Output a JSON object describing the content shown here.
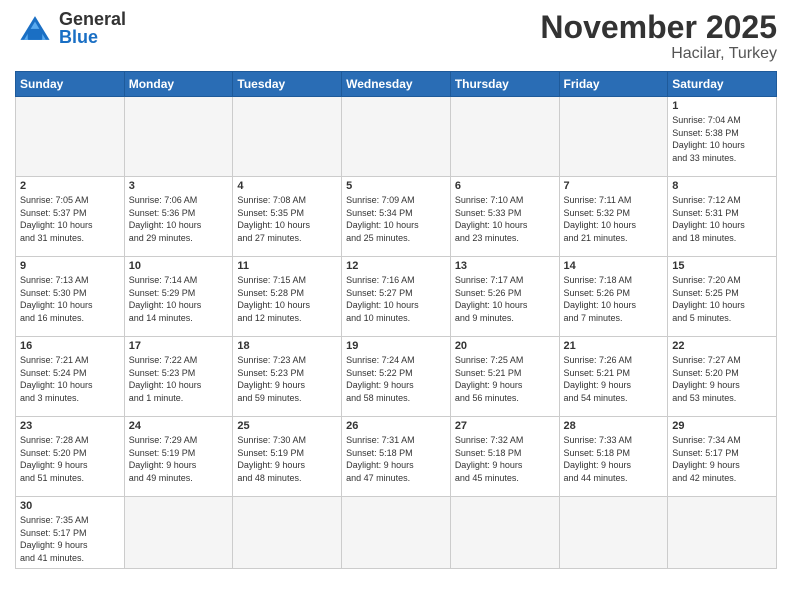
{
  "header": {
    "logo_general": "General",
    "logo_blue": "Blue",
    "month": "November 2025",
    "location": "Hacilar, Turkey"
  },
  "weekdays": [
    "Sunday",
    "Monday",
    "Tuesday",
    "Wednesday",
    "Thursday",
    "Friday",
    "Saturday"
  ],
  "weeks": [
    [
      {
        "day": "",
        "info": ""
      },
      {
        "day": "",
        "info": ""
      },
      {
        "day": "",
        "info": ""
      },
      {
        "day": "",
        "info": ""
      },
      {
        "day": "",
        "info": ""
      },
      {
        "day": "",
        "info": ""
      },
      {
        "day": "1",
        "info": "Sunrise: 7:04 AM\nSunset: 5:38 PM\nDaylight: 10 hours\nand 33 minutes."
      }
    ],
    [
      {
        "day": "2",
        "info": "Sunrise: 7:05 AM\nSunset: 5:37 PM\nDaylight: 10 hours\nand 31 minutes."
      },
      {
        "day": "3",
        "info": "Sunrise: 7:06 AM\nSunset: 5:36 PM\nDaylight: 10 hours\nand 29 minutes."
      },
      {
        "day": "4",
        "info": "Sunrise: 7:08 AM\nSunset: 5:35 PM\nDaylight: 10 hours\nand 27 minutes."
      },
      {
        "day": "5",
        "info": "Sunrise: 7:09 AM\nSunset: 5:34 PM\nDaylight: 10 hours\nand 25 minutes."
      },
      {
        "day": "6",
        "info": "Sunrise: 7:10 AM\nSunset: 5:33 PM\nDaylight: 10 hours\nand 23 minutes."
      },
      {
        "day": "7",
        "info": "Sunrise: 7:11 AM\nSunset: 5:32 PM\nDaylight: 10 hours\nand 21 minutes."
      },
      {
        "day": "8",
        "info": "Sunrise: 7:12 AM\nSunset: 5:31 PM\nDaylight: 10 hours\nand 18 minutes."
      }
    ],
    [
      {
        "day": "9",
        "info": "Sunrise: 7:13 AM\nSunset: 5:30 PM\nDaylight: 10 hours\nand 16 minutes."
      },
      {
        "day": "10",
        "info": "Sunrise: 7:14 AM\nSunset: 5:29 PM\nDaylight: 10 hours\nand 14 minutes."
      },
      {
        "day": "11",
        "info": "Sunrise: 7:15 AM\nSunset: 5:28 PM\nDaylight: 10 hours\nand 12 minutes."
      },
      {
        "day": "12",
        "info": "Sunrise: 7:16 AM\nSunset: 5:27 PM\nDaylight: 10 hours\nand 10 minutes."
      },
      {
        "day": "13",
        "info": "Sunrise: 7:17 AM\nSunset: 5:26 PM\nDaylight: 10 hours\nand 9 minutes."
      },
      {
        "day": "14",
        "info": "Sunrise: 7:18 AM\nSunset: 5:26 PM\nDaylight: 10 hours\nand 7 minutes."
      },
      {
        "day": "15",
        "info": "Sunrise: 7:20 AM\nSunset: 5:25 PM\nDaylight: 10 hours\nand 5 minutes."
      }
    ],
    [
      {
        "day": "16",
        "info": "Sunrise: 7:21 AM\nSunset: 5:24 PM\nDaylight: 10 hours\nand 3 minutes."
      },
      {
        "day": "17",
        "info": "Sunrise: 7:22 AM\nSunset: 5:23 PM\nDaylight: 10 hours\nand 1 minute."
      },
      {
        "day": "18",
        "info": "Sunrise: 7:23 AM\nSunset: 5:23 PM\nDaylight: 9 hours\nand 59 minutes."
      },
      {
        "day": "19",
        "info": "Sunrise: 7:24 AM\nSunset: 5:22 PM\nDaylight: 9 hours\nand 58 minutes."
      },
      {
        "day": "20",
        "info": "Sunrise: 7:25 AM\nSunset: 5:21 PM\nDaylight: 9 hours\nand 56 minutes."
      },
      {
        "day": "21",
        "info": "Sunrise: 7:26 AM\nSunset: 5:21 PM\nDaylight: 9 hours\nand 54 minutes."
      },
      {
        "day": "22",
        "info": "Sunrise: 7:27 AM\nSunset: 5:20 PM\nDaylight: 9 hours\nand 53 minutes."
      }
    ],
    [
      {
        "day": "23",
        "info": "Sunrise: 7:28 AM\nSunset: 5:20 PM\nDaylight: 9 hours\nand 51 minutes."
      },
      {
        "day": "24",
        "info": "Sunrise: 7:29 AM\nSunset: 5:19 PM\nDaylight: 9 hours\nand 49 minutes."
      },
      {
        "day": "25",
        "info": "Sunrise: 7:30 AM\nSunset: 5:19 PM\nDaylight: 9 hours\nand 48 minutes."
      },
      {
        "day": "26",
        "info": "Sunrise: 7:31 AM\nSunset: 5:18 PM\nDaylight: 9 hours\nand 47 minutes."
      },
      {
        "day": "27",
        "info": "Sunrise: 7:32 AM\nSunset: 5:18 PM\nDaylight: 9 hours\nand 45 minutes."
      },
      {
        "day": "28",
        "info": "Sunrise: 7:33 AM\nSunset: 5:18 PM\nDaylight: 9 hours\nand 44 minutes."
      },
      {
        "day": "29",
        "info": "Sunrise: 7:34 AM\nSunset: 5:17 PM\nDaylight: 9 hours\nand 42 minutes."
      }
    ],
    [
      {
        "day": "30",
        "info": "Sunrise: 7:35 AM\nSunset: 5:17 PM\nDaylight: 9 hours\nand 41 minutes."
      },
      {
        "day": "",
        "info": ""
      },
      {
        "day": "",
        "info": ""
      },
      {
        "day": "",
        "info": ""
      },
      {
        "day": "",
        "info": ""
      },
      {
        "day": "",
        "info": ""
      },
      {
        "day": "",
        "info": ""
      }
    ]
  ]
}
